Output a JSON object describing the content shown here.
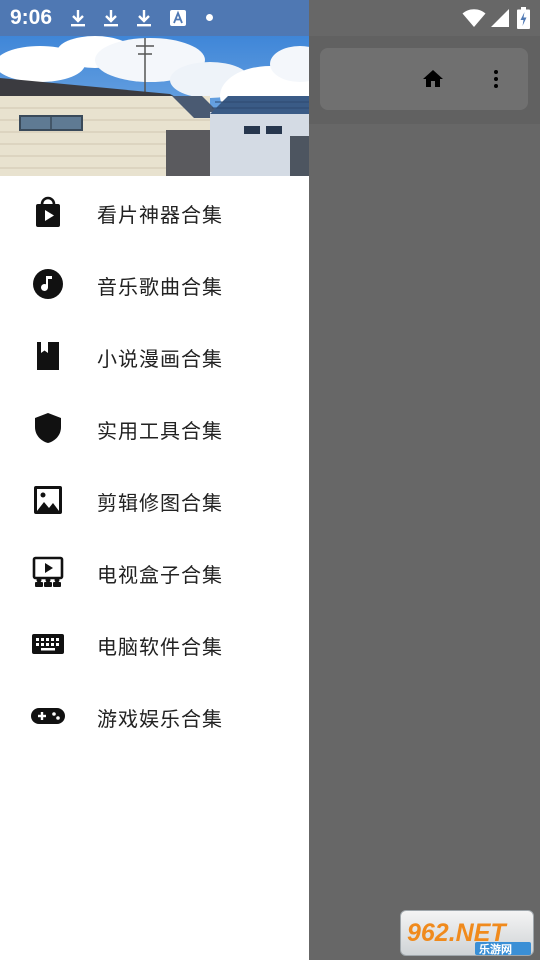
{
  "status_bar": {
    "time": "9:06",
    "icons": [
      "download-icon",
      "download-icon",
      "download-icon",
      "translate-icon",
      "dot-icon",
      "wifi-icon",
      "signal-icon",
      "battery-charging-icon"
    ]
  },
  "drawer": {
    "items": [
      {
        "label": "看片神器合集",
        "icon": "play-bag-icon"
      },
      {
        "label": "音乐歌曲合集",
        "icon": "music-note-icon"
      },
      {
        "label": "小说漫画合集",
        "icon": "book-icon"
      },
      {
        "label": "实用工具合集",
        "icon": "shield-icon"
      },
      {
        "label": "剪辑修图合集",
        "icon": "image-icon"
      },
      {
        "label": "电视盒子合集",
        "icon": "tv-screen-icon"
      },
      {
        "label": "电脑软件合集",
        "icon": "keyboard-icon"
      },
      {
        "label": "游戏娱乐合集",
        "icon": "gamepad-icon"
      }
    ]
  },
  "toolbar": {
    "icons": [
      "home-icon",
      "more-vert-icon"
    ]
  },
  "watermark": {
    "brand": "962.NET",
    "subtitle": "乐游网"
  },
  "colors": {
    "status_bar": "#4f78b3",
    "scrim": "#6b6b6b",
    "drawer": "#ffffff",
    "icon": "#111111",
    "text": "#222222"
  }
}
